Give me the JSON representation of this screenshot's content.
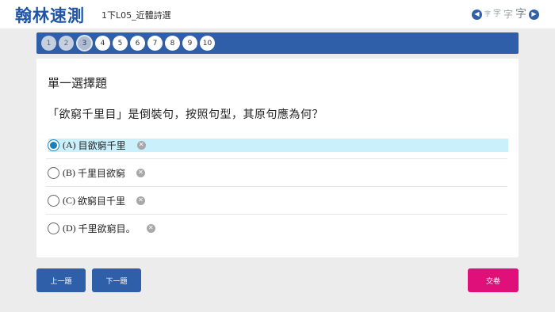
{
  "header": {
    "logo": "翰林速測",
    "lesson_title": "1下L05_近體詩選",
    "font_size_control": {
      "left_icon": "arrow-left-icon",
      "right_icon": "arrow-right-icon",
      "sizes": [
        "字",
        "字",
        "字",
        "字"
      ]
    }
  },
  "question_nav": {
    "numbers": [
      "1",
      "2",
      "3",
      "4",
      "5",
      "6",
      "7",
      "8",
      "9",
      "10"
    ],
    "current": "3"
  },
  "question": {
    "type": "單一選擇題",
    "stem": "「欲窮千里目」是倒裝句，按照句型，其原句應為何？",
    "options": [
      {
        "label": "(A)",
        "text": "目欲窮千里",
        "selected": true
      },
      {
        "label": "(B)",
        "text": "千里目欲窮",
        "selected": false
      },
      {
        "label": "(C)",
        "text": "欲窮目千里",
        "selected": false
      },
      {
        "label": "(D)",
        "text": "千里欲窮目。",
        "selected": false
      }
    ]
  },
  "footer": {
    "prev_label": "上一題",
    "next_label": "下一題",
    "submit_label": "交卷"
  },
  "colors": {
    "brand_blue": "#2f5fa8",
    "submit_pink": "#e0107a",
    "selected_highlight": "#c9f0fb"
  }
}
